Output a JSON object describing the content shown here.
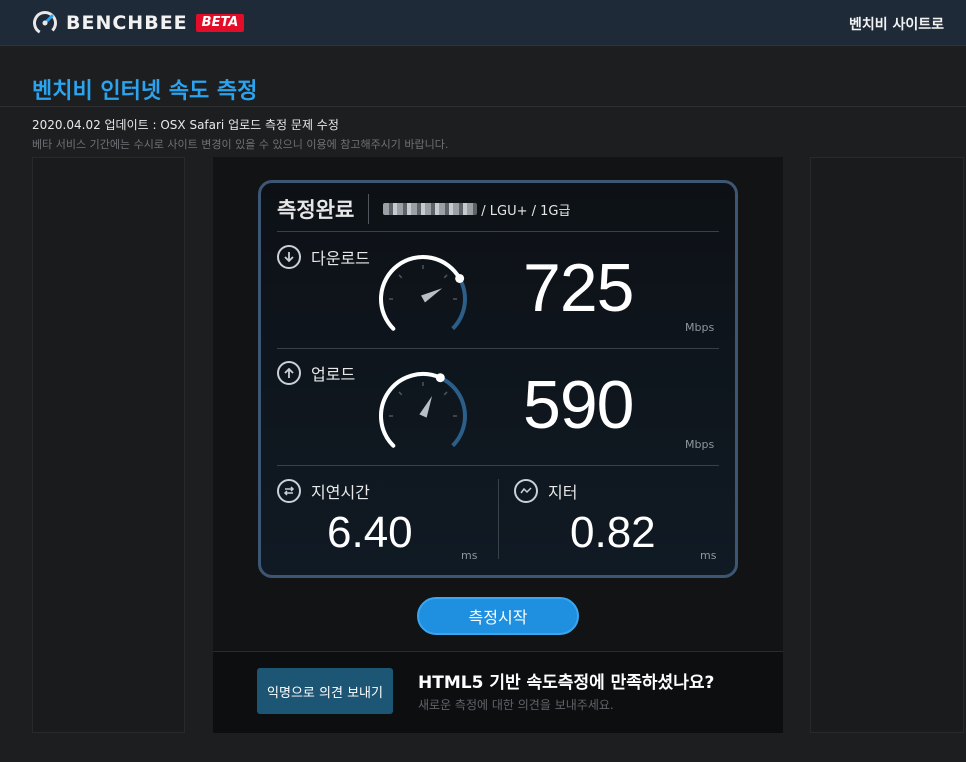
{
  "header": {
    "brand": "BENCHBEE",
    "badge": "BETA",
    "site_link": "벤치비 사이트로"
  },
  "page": {
    "title": "벤치비 인터넷 속도 측정",
    "update": "2020.04.02 업데이트 : OSX Safari 업로드 측정 문제 수정",
    "notice": "베타 서비스 기간에는 수시로 사이트 변경이 있을 수 있으니 이용에 참고해주시기 바랍니다."
  },
  "result": {
    "status": "측정완료",
    "isp": "/ LGU+ / 1G급",
    "download": {
      "label": "다운로드",
      "value": "725",
      "unit": "Mbps",
      "gauge_fraction": 0.725
    },
    "upload": {
      "label": "업로드",
      "value": "590",
      "unit": "Mbps",
      "gauge_fraction": 0.59
    },
    "latency": {
      "label": "지연시간",
      "value": "6.40",
      "unit": "ms"
    },
    "jitter": {
      "label": "지터",
      "value": "0.82",
      "unit": "ms"
    }
  },
  "actions": {
    "start": "측정시작"
  },
  "feedback": {
    "button": "익명으로 의견 보내기",
    "question": "HTML5 기반 속도측정에 만족하셨나요?",
    "subtext": "새로운 측정에 대한 의견을 보내주세요."
  },
  "colors": {
    "accent": "#2ba3ee",
    "button": "#1f8fe0",
    "gauge_track": "#2b5f8a",
    "badge": "#e30d2a"
  }
}
